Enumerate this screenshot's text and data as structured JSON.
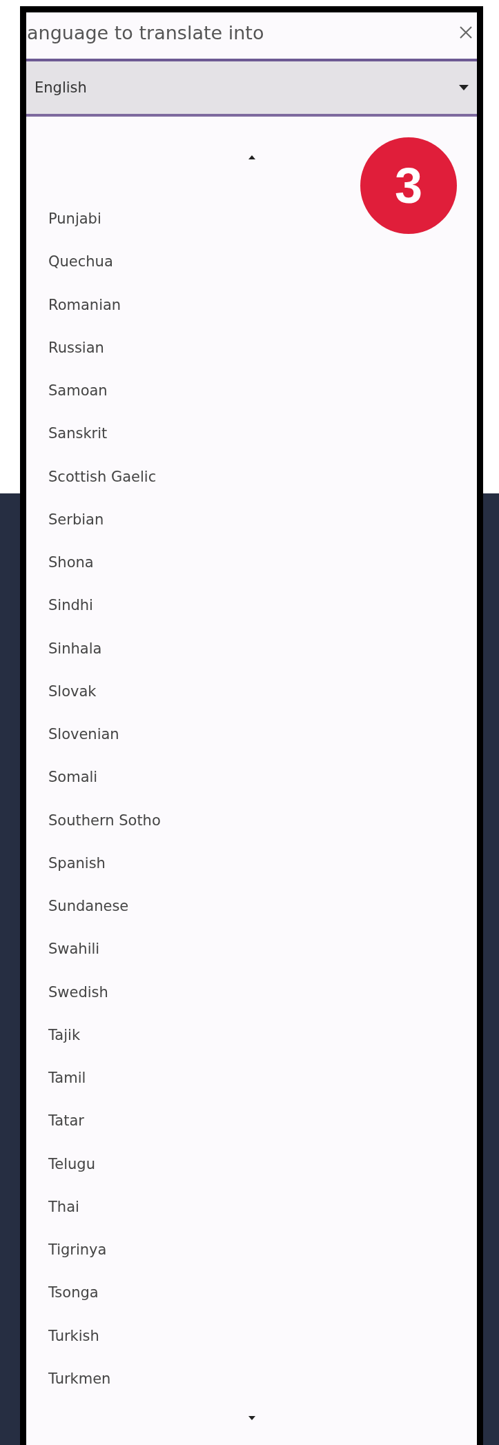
{
  "dialog": {
    "title": "anguage to translate into"
  },
  "dropdown": {
    "value": "English"
  },
  "languages": [
    "Punjabi",
    "Quechua",
    "Romanian",
    "Russian",
    "Samoan",
    "Sanskrit",
    "Scottish Gaelic",
    "Serbian",
    "Shona",
    "Sindhi",
    "Sinhala",
    "Slovak",
    "Slovenian",
    "Somali",
    "Southern Sotho",
    "Spanish",
    "Sundanese",
    "Swahili",
    "Swedish",
    "Tajik",
    "Tamil",
    "Tatar",
    "Telugu",
    "Thai",
    "Tigrinya",
    "Tsonga",
    "Turkish",
    "Turkmen"
  ],
  "badge": "3"
}
